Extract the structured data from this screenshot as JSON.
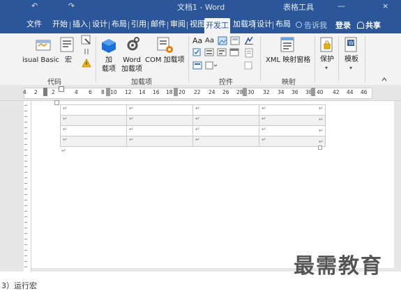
{
  "titlebar": {
    "quick_access": "↶ ↷",
    "doc_title": "文档1 - Word",
    "table_tools": "表格工具",
    "ctrl_min": "—",
    "ctrl_close": "×"
  },
  "tabs": [
    {
      "label": "文件"
    },
    {
      "label": "开始"
    },
    {
      "label": "插入"
    },
    {
      "label": "设计"
    },
    {
      "label": "布局"
    },
    {
      "label": "引用"
    },
    {
      "label": "邮件"
    },
    {
      "label": "审阅"
    },
    {
      "label": "视图"
    },
    {
      "label": "开发工"
    },
    {
      "label": "加载项"
    },
    {
      "label": "设计"
    },
    {
      "label": "布局"
    }
  ],
  "tell_me": "告诉我",
  "login": "登录",
  "share": "共享",
  "ribbon": {
    "code": {
      "visual_basic": "isual Basic",
      "macro": "宏",
      "label": "代码"
    },
    "addins": {
      "addin": "加\n载项",
      "word_addin": "Word\n加载项",
      "com_addin": "COM 加载项",
      "label": "加载项"
    },
    "controls": {
      "label": "控件",
      "aa1": "Aa",
      "aa2": "Aa"
    },
    "mapping": {
      "xml_pane": "XML 映射窗格",
      "label": "映射"
    },
    "protect": {
      "protect": "保护",
      "template": "模板"
    }
  },
  "ruler": {
    "numbers": [
      "4",
      "2",
      "2",
      "4",
      "6",
      "8",
      "10",
      "12",
      "14",
      "16",
      "18",
      "20",
      "22",
      "24",
      "26",
      "28",
      "30",
      "32",
      "34",
      "36",
      "38",
      "40",
      "42",
      "44",
      "46"
    ]
  },
  "table": {
    "rows": [
      [
        "↵",
        "↵",
        "↵",
        "↵"
      ],
      [
        "↵",
        "↵",
        "↵",
        "↵"
      ],
      [
        "↵",
        "↵",
        "↵",
        "↵"
      ],
      [
        "↵",
        "↵",
        "↵",
        "↵"
      ]
    ],
    "row_end_mark": "↵",
    "para_mark": "↵"
  },
  "watermark": "最需教育",
  "caption": "3）运行宏",
  "colors": {
    "accent": "#2b579a",
    "ribbon_bg": "#f3f3f3",
    "doc_bg": "#e7e7e7"
  }
}
